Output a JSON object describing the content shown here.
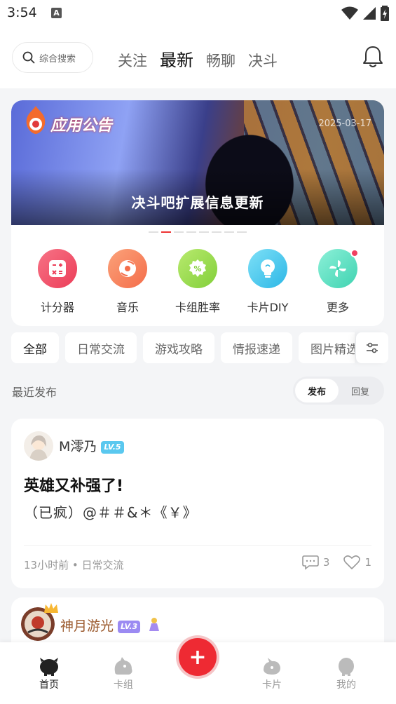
{
  "status_bar": {
    "time": "3:54",
    "notif_icon": "A"
  },
  "header": {
    "search_placeholder": "综合搜索",
    "tabs": [
      {
        "label": "关注",
        "active": false
      },
      {
        "label": "最新",
        "active": true
      },
      {
        "label": "畅聊",
        "active": false
      },
      {
        "label": "决斗",
        "active": false
      }
    ]
  },
  "banner": {
    "logo_text": "应用公告",
    "date": "2025-03-17",
    "title": "决斗吧扩展信息更新",
    "page_count": 8,
    "active_page": 1
  },
  "shortcuts": [
    {
      "label": "计分器",
      "icon": "calculator-icon",
      "color": "#f2566e"
    },
    {
      "label": "音乐",
      "icon": "music-disc-icon",
      "color": "#f7875f"
    },
    {
      "label": "卡组胜率",
      "icon": "percent-badge-icon",
      "color": "#9ed84c"
    },
    {
      "label": "卡片DIY",
      "icon": "lightbulb-icon",
      "color": "#4cc8ef"
    },
    {
      "label": "更多",
      "icon": "pinwheel-icon",
      "color": "#5fe0c5",
      "has_dot": true
    }
  ],
  "categories": [
    "全部",
    "日常交流",
    "游戏攻略",
    "情报速递",
    "图片精选"
  ],
  "recent": {
    "label": "最近发布",
    "segments": [
      {
        "label": "发布",
        "active": true
      },
      {
        "label": "回复",
        "active": false
      }
    ]
  },
  "posts": [
    {
      "username": "M澪乃",
      "level": "LV.5",
      "level_color": "#5ac8ef",
      "title": "英雄又补强了!",
      "body": "（已疯）@＃＃&＊《￥》",
      "meta": "13小时前 • 日常交流",
      "comments": "3",
      "likes": "1"
    },
    {
      "username": "神月游光",
      "level": "LV.3",
      "level_color": "#9b8af2"
    }
  ],
  "bottom_nav": [
    {
      "label": "首页",
      "active": true
    },
    {
      "label": "卡组",
      "active": false
    },
    {
      "label": "卡片",
      "active": false
    },
    {
      "label": "我的",
      "active": false
    }
  ],
  "colors": {
    "accent": "#ee2a33",
    "background": "#f4f5f7"
  }
}
